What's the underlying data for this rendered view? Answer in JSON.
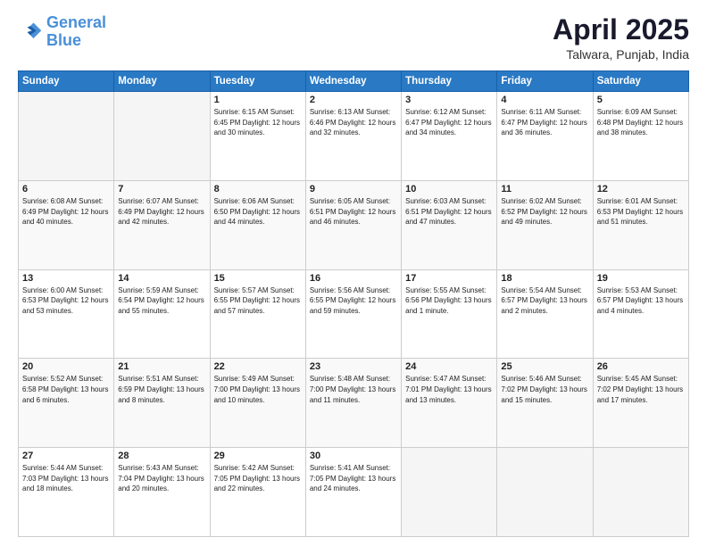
{
  "header": {
    "logo_line1": "General",
    "logo_line2": "Blue",
    "month": "April 2025",
    "location": "Talwara, Punjab, India"
  },
  "days_of_week": [
    "Sunday",
    "Monday",
    "Tuesday",
    "Wednesday",
    "Thursday",
    "Friday",
    "Saturday"
  ],
  "weeks": [
    [
      {
        "day": "",
        "content": ""
      },
      {
        "day": "",
        "content": ""
      },
      {
        "day": "1",
        "content": "Sunrise: 6:15 AM\nSunset: 6:45 PM\nDaylight: 12 hours\nand 30 minutes."
      },
      {
        "day": "2",
        "content": "Sunrise: 6:13 AM\nSunset: 6:46 PM\nDaylight: 12 hours\nand 32 minutes."
      },
      {
        "day": "3",
        "content": "Sunrise: 6:12 AM\nSunset: 6:47 PM\nDaylight: 12 hours\nand 34 minutes."
      },
      {
        "day": "4",
        "content": "Sunrise: 6:11 AM\nSunset: 6:47 PM\nDaylight: 12 hours\nand 36 minutes."
      },
      {
        "day": "5",
        "content": "Sunrise: 6:09 AM\nSunset: 6:48 PM\nDaylight: 12 hours\nand 38 minutes."
      }
    ],
    [
      {
        "day": "6",
        "content": "Sunrise: 6:08 AM\nSunset: 6:49 PM\nDaylight: 12 hours\nand 40 minutes."
      },
      {
        "day": "7",
        "content": "Sunrise: 6:07 AM\nSunset: 6:49 PM\nDaylight: 12 hours\nand 42 minutes."
      },
      {
        "day": "8",
        "content": "Sunrise: 6:06 AM\nSunset: 6:50 PM\nDaylight: 12 hours\nand 44 minutes."
      },
      {
        "day": "9",
        "content": "Sunrise: 6:05 AM\nSunset: 6:51 PM\nDaylight: 12 hours\nand 46 minutes."
      },
      {
        "day": "10",
        "content": "Sunrise: 6:03 AM\nSunset: 6:51 PM\nDaylight: 12 hours\nand 47 minutes."
      },
      {
        "day": "11",
        "content": "Sunrise: 6:02 AM\nSunset: 6:52 PM\nDaylight: 12 hours\nand 49 minutes."
      },
      {
        "day": "12",
        "content": "Sunrise: 6:01 AM\nSunset: 6:53 PM\nDaylight: 12 hours\nand 51 minutes."
      }
    ],
    [
      {
        "day": "13",
        "content": "Sunrise: 6:00 AM\nSunset: 6:53 PM\nDaylight: 12 hours\nand 53 minutes."
      },
      {
        "day": "14",
        "content": "Sunrise: 5:59 AM\nSunset: 6:54 PM\nDaylight: 12 hours\nand 55 minutes."
      },
      {
        "day": "15",
        "content": "Sunrise: 5:57 AM\nSunset: 6:55 PM\nDaylight: 12 hours\nand 57 minutes."
      },
      {
        "day": "16",
        "content": "Sunrise: 5:56 AM\nSunset: 6:55 PM\nDaylight: 12 hours\nand 59 minutes."
      },
      {
        "day": "17",
        "content": "Sunrise: 5:55 AM\nSunset: 6:56 PM\nDaylight: 13 hours\nand 1 minute."
      },
      {
        "day": "18",
        "content": "Sunrise: 5:54 AM\nSunset: 6:57 PM\nDaylight: 13 hours\nand 2 minutes."
      },
      {
        "day": "19",
        "content": "Sunrise: 5:53 AM\nSunset: 6:57 PM\nDaylight: 13 hours\nand 4 minutes."
      }
    ],
    [
      {
        "day": "20",
        "content": "Sunrise: 5:52 AM\nSunset: 6:58 PM\nDaylight: 13 hours\nand 6 minutes."
      },
      {
        "day": "21",
        "content": "Sunrise: 5:51 AM\nSunset: 6:59 PM\nDaylight: 13 hours\nand 8 minutes."
      },
      {
        "day": "22",
        "content": "Sunrise: 5:49 AM\nSunset: 7:00 PM\nDaylight: 13 hours\nand 10 minutes."
      },
      {
        "day": "23",
        "content": "Sunrise: 5:48 AM\nSunset: 7:00 PM\nDaylight: 13 hours\nand 11 minutes."
      },
      {
        "day": "24",
        "content": "Sunrise: 5:47 AM\nSunset: 7:01 PM\nDaylight: 13 hours\nand 13 minutes."
      },
      {
        "day": "25",
        "content": "Sunrise: 5:46 AM\nSunset: 7:02 PM\nDaylight: 13 hours\nand 15 minutes."
      },
      {
        "day": "26",
        "content": "Sunrise: 5:45 AM\nSunset: 7:02 PM\nDaylight: 13 hours\nand 17 minutes."
      }
    ],
    [
      {
        "day": "27",
        "content": "Sunrise: 5:44 AM\nSunset: 7:03 PM\nDaylight: 13 hours\nand 18 minutes."
      },
      {
        "day": "28",
        "content": "Sunrise: 5:43 AM\nSunset: 7:04 PM\nDaylight: 13 hours\nand 20 minutes."
      },
      {
        "day": "29",
        "content": "Sunrise: 5:42 AM\nSunset: 7:05 PM\nDaylight: 13 hours\nand 22 minutes."
      },
      {
        "day": "30",
        "content": "Sunrise: 5:41 AM\nSunset: 7:05 PM\nDaylight: 13 hours\nand 24 minutes."
      },
      {
        "day": "",
        "content": ""
      },
      {
        "day": "",
        "content": ""
      },
      {
        "day": "",
        "content": ""
      }
    ]
  ]
}
